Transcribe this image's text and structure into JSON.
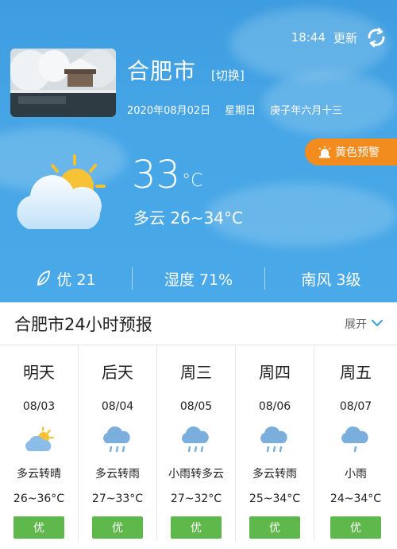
{
  "header": {
    "time": "18:44",
    "refresh_label": "更新",
    "city": "合肥市",
    "switch_label": "[切换]",
    "date": "2020年08月02日",
    "weekday": "星期日",
    "lunar": "庚子年六月十三",
    "alert_label": "黄色预警"
  },
  "current": {
    "temp": "33",
    "unit": "°C",
    "condition": "多云 26~34°C",
    "icon": "partly-cloudy-icon"
  },
  "stats": {
    "aqi": "优 21",
    "humidity": "湿度 71%",
    "wind": "南风 3级"
  },
  "forecast": {
    "title": "合肥市24小时预报",
    "expand_label": "展开",
    "days": [
      {
        "day": "明天",
        "date": "08/03",
        "icon": "partly-cloudy-icon",
        "desc": "多云转晴",
        "range": "26~36°C",
        "aqi": "优"
      },
      {
        "day": "后天",
        "date": "08/04",
        "icon": "rain-cloud-icon",
        "desc": "多云转雨",
        "range": "27~33°C",
        "aqi": "优"
      },
      {
        "day": "周三",
        "date": "08/05",
        "icon": "rain-cloud-icon",
        "desc": "小雨转多云",
        "range": "27~32°C",
        "aqi": "优"
      },
      {
        "day": "周四",
        "date": "08/06",
        "icon": "rain-cloud-icon",
        "desc": "多云转雨",
        "range": "25~34°C",
        "aqi": "优"
      },
      {
        "day": "周五",
        "date": "08/07",
        "icon": "light-rain-icon",
        "desc": "小雨",
        "range": "24~34°C",
        "aqi": "优"
      }
    ]
  },
  "colors": {
    "sky": "#46a6e6",
    "alert": "#f28c1e",
    "aqi_good": "#5fb84b",
    "rain_icon": "#7aaedc"
  }
}
